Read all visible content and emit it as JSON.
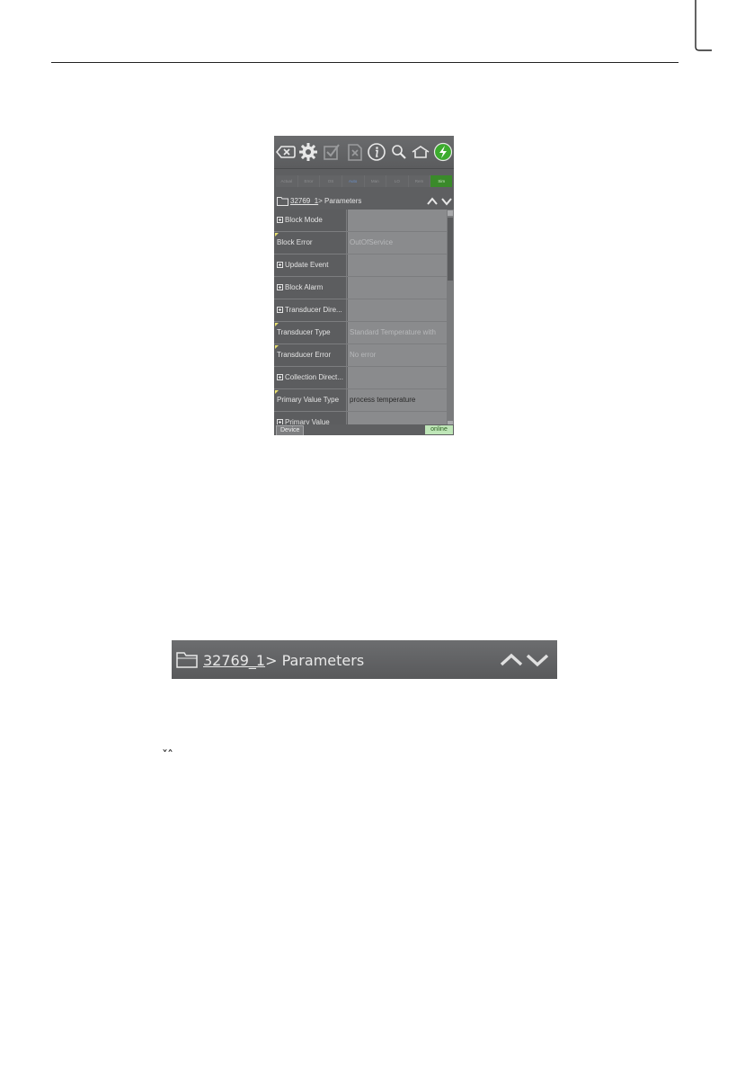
{
  "toolbar": {
    "icons": [
      "backspace-icon",
      "gear-icon",
      "check-icon",
      "cancel-icon",
      "info-icon",
      "search-icon",
      "home-icon",
      "online-lightning-icon"
    ]
  },
  "mode_bar": {
    "cells": [
      {
        "label": "Actual",
        "state": "normal"
      },
      {
        "label": "Error",
        "state": "normal"
      },
      {
        "label": "OS",
        "state": "normal"
      },
      {
        "label": "Auto",
        "state": "active"
      },
      {
        "label": "Man",
        "state": "normal"
      },
      {
        "label": "LO",
        "state": "normal"
      },
      {
        "label": "Rem",
        "state": "normal"
      },
      {
        "label": "Sim",
        "state": "sim"
      }
    ]
  },
  "nav": {
    "link": "32769_1",
    "rest": "> Parameters"
  },
  "parameters": [
    {
      "name": "Block Mode",
      "expandable": true,
      "value": ""
    },
    {
      "name": "Block Error",
      "expandable": false,
      "value": "OutOfService"
    },
    {
      "name": "Update Event",
      "expandable": true,
      "value": ""
    },
    {
      "name": "Block Alarm",
      "expandable": true,
      "value": ""
    },
    {
      "name": "Transducer Dire...",
      "expandable": true,
      "value": ""
    },
    {
      "name": "Transducer Type",
      "expandable": false,
      "value": "Standard Temperature with"
    },
    {
      "name": "Transducer Error",
      "expandable": false,
      "value": "No error"
    },
    {
      "name": "Collection Direct...",
      "expandable": true,
      "value": ""
    },
    {
      "name": "Primary Value Type",
      "expandable": false,
      "value": "process temperature",
      "value_dark": true
    },
    {
      "name": "Primary Value",
      "expandable": true,
      "value": ""
    }
  ],
  "status": {
    "tab": "Device",
    "connection": "online"
  },
  "zoom": {
    "link": "32769_1",
    "rest": "> Parameters"
  },
  "inline_glyphs": "ˇˆ",
  "colors": {
    "panel_bg": "#5e5f61",
    "value_bg": "#8a8b8d",
    "online_bg": "#bfe6b8",
    "sim_bg": "#3a8a2a",
    "lightning_green": "#3cab2e"
  }
}
